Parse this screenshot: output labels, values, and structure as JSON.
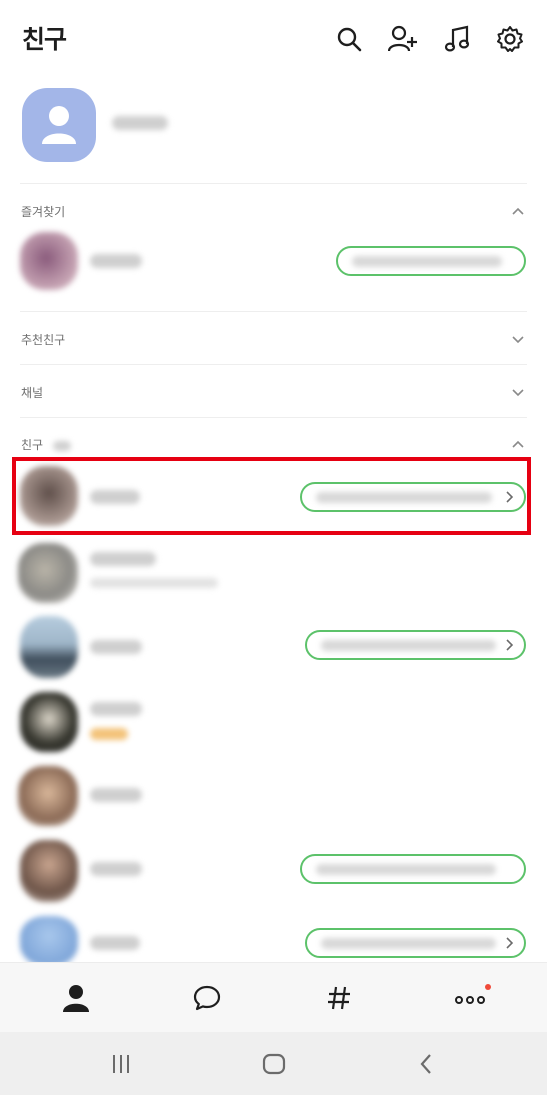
{
  "header": {
    "title": "친구",
    "icons": [
      "search-icon",
      "add-friend-icon",
      "music-icon",
      "settings-icon"
    ]
  },
  "sections": {
    "favorites_label": "즐겨찾기",
    "recommended_label": "추천친구",
    "channel_label": "채널",
    "friends_label": "친구"
  },
  "tabbar": {
    "tabs": [
      "friends-tab",
      "chats-tab",
      "openchat-tab",
      "more-tab"
    ],
    "more_has_badge": true
  },
  "system_nav": [
    "recent-apps-button",
    "home-button",
    "back-button"
  ],
  "colors": {
    "accent_green": "#5cc26a",
    "highlight_red": "#e60012",
    "my_avatar_bg": "#a3b6e8",
    "badge_red": "#f04a3a"
  }
}
